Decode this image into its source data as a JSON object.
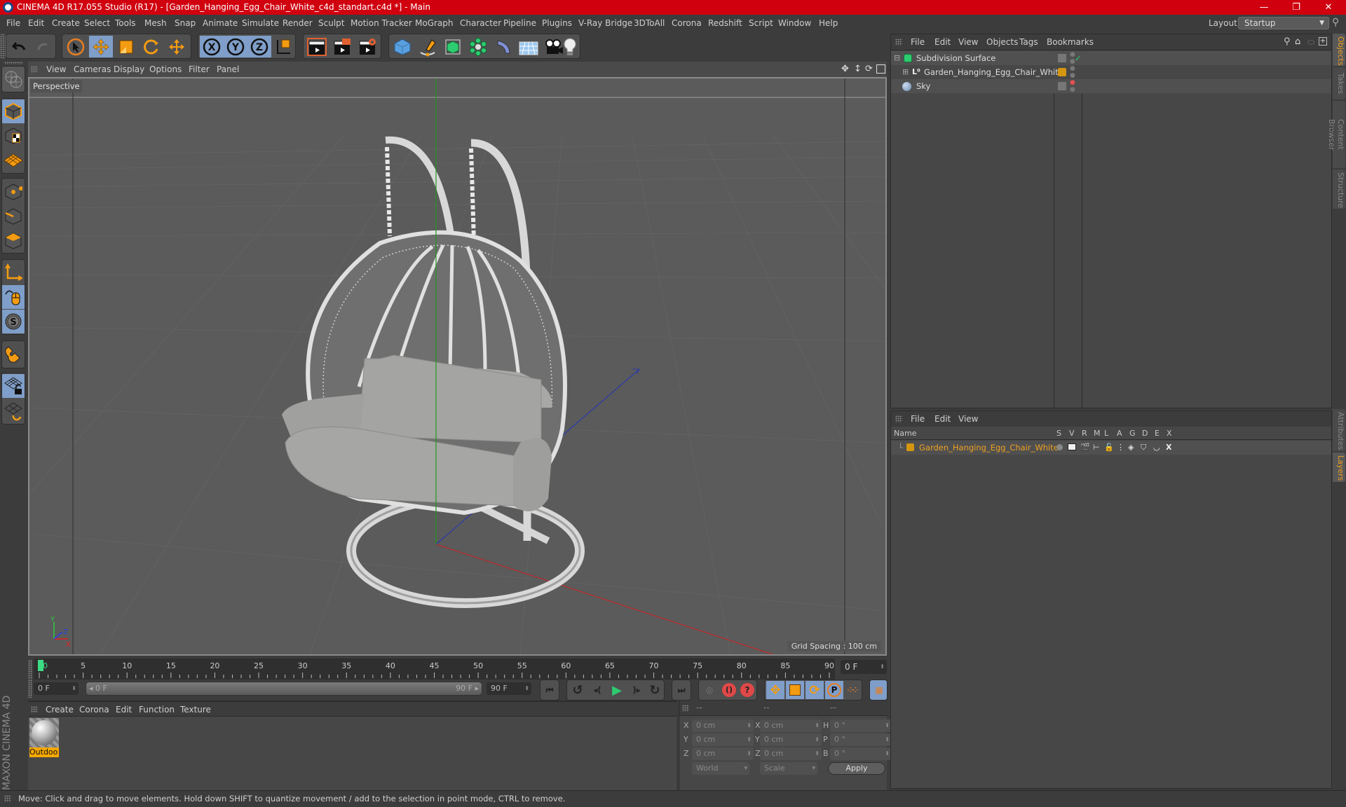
{
  "window": {
    "title": "CINEMA 4D R17.055 Studio (R17) - [Garden_Hanging_Egg_Chair_White_c4d_standart.c4d *] - Main",
    "controls": {
      "minimize": "—",
      "maximize": "❐",
      "close": "✕"
    }
  },
  "menubar": {
    "items": [
      "File",
      "Edit",
      "Create",
      "Select",
      "Tools",
      "Mesh",
      "Snap",
      "Animate",
      "Simulate",
      "Render",
      "Sculpt",
      "Motion Tracker",
      "MoGraph",
      "Character",
      "Pipeline",
      "Plugins",
      "V-Ray Bridge",
      "3DToAll",
      "Corona",
      "Redshift",
      "Script",
      "Window",
      "Help"
    ],
    "layout_label": "Layout:",
    "layout_value": "Startup"
  },
  "toolbar": {
    "icons": [
      "undo-icon",
      "redo-icon",
      "select-live-icon",
      "move-icon",
      "scale-icon",
      "rotate-icon",
      "transform-icon",
      "x-axis-lock-icon",
      "y-axis-lock-icon",
      "z-axis-lock-icon",
      "coordinate-system-icon",
      "render-view-icon",
      "render-picture-viewer-icon",
      "render-settings-icon",
      "cube-icon",
      "pen-spline-icon",
      "subdivision-icon",
      "cloner-icon",
      "deformer-icon",
      "floor-icon",
      "camera-icon",
      "light-icon"
    ]
  },
  "left_tools": {
    "icons": [
      "make-editable-icon",
      "model-mode-icon",
      "texture-mode-icon",
      "workplane-mode-icon",
      "points-mode-icon",
      "edges-mode-icon",
      "polygons-mode-icon",
      "axis-mode-icon",
      "tweak-mode-icon",
      "solo-mode-icon",
      "snapping-icon",
      "lock-workplane-icon",
      "workplane-rotate-icon"
    ]
  },
  "viewport": {
    "menu": [
      "View",
      "Cameras",
      "Display",
      "Options",
      "Filter",
      "Panel"
    ],
    "camera_label": "Perspective",
    "grid_spacing": "Grid Spacing : 100 cm",
    "axis_labels": {
      "x": "X",
      "y": "Y",
      "z": "Z"
    },
    "nav_icons": [
      "pan-icon",
      "dolly-icon",
      "orbit-icon",
      "maximize-view-icon"
    ]
  },
  "timeline": {
    "ticks": [
      "0",
      "5",
      "10",
      "15",
      "20",
      "25",
      "30",
      "35",
      "40",
      "45",
      "50",
      "55",
      "60",
      "65",
      "70",
      "75",
      "80",
      "85",
      "90"
    ],
    "current_frame": "0 F",
    "start_field": "0 F",
    "range_start": "0 F",
    "range_end": "90 F",
    "end_field": "90 F",
    "range_min": 0,
    "range_max": 90,
    "playhead": 0
  },
  "playback": {
    "buttons": [
      "go-to-start",
      "go-to-prev-key",
      "play-reverse-step",
      "play",
      "play-forward-step",
      "go-to-next-key",
      "go-to-end",
      "motion-record",
      "record-keys",
      "autokey-help",
      "key-position",
      "key-scale",
      "key-rotation",
      "key-param",
      "key-pla",
      "timeline-window"
    ]
  },
  "materials": {
    "menu": [
      "Create",
      "Corona",
      "Edit",
      "Function",
      "Texture"
    ],
    "items": [
      {
        "name": "Outdoo"
      }
    ]
  },
  "coordinates": {
    "headers": [
      "--",
      "--",
      "--"
    ],
    "rows": [
      {
        "a": "X",
        "av": "0 cm",
        "b": "X",
        "bv": "0 cm",
        "c": "H",
        "cv": "0 °"
      },
      {
        "a": "Y",
        "av": "0 cm",
        "b": "Y",
        "bv": "0 cm",
        "c": "P",
        "cv": "0 °"
      },
      {
        "a": "Z",
        "av": "0 cm",
        "b": "Z",
        "bv": "0 cm",
        "c": "B",
        "cv": "0 °"
      }
    ],
    "space_select": "World",
    "mode_select": "Scale",
    "apply_label": "Apply"
  },
  "objects_panel": {
    "menu": [
      "File",
      "Edit",
      "View",
      "Objects",
      "Tags",
      "Bookmarks"
    ],
    "rows": [
      {
        "name": "Subdivision Surface",
        "icon": "subdivision-icon",
        "expand": "⊟"
      },
      {
        "name": "Garden_Hanging_Egg_Chair_White",
        "icon": "null-object-icon",
        "expand": "⊞"
      },
      {
        "name": "Sky",
        "icon": "sky-icon",
        "expand": ""
      }
    ]
  },
  "layers_panel": {
    "menu": [
      "File",
      "Edit",
      "View"
    ],
    "columns": [
      "Name",
      "S",
      "V",
      "R",
      "M",
      "L",
      "A",
      "G",
      "D",
      "E",
      "X"
    ],
    "rows": [
      {
        "name": "Garden_Hanging_Egg_Chair_White",
        "color": "#d4960f"
      }
    ]
  },
  "side_tabs": {
    "top": [
      {
        "label": "Objects",
        "active": true
      },
      {
        "label": "Takes",
        "active": false
      },
      {
        "label": "Content Browser",
        "active": false
      },
      {
        "label": "Structure",
        "active": false
      }
    ],
    "bottom": [
      {
        "label": "Attributes",
        "active": false
      },
      {
        "label": "Layers",
        "active": true
      }
    ]
  },
  "branding": "MAXON CINEMA 4D",
  "status": "Move: Click and drag to move elements. Hold down SHIFT to quantize movement / add to the selection in point mode, CTRL to remove.",
  "colors": {
    "accent": "#f0a020",
    "title_bar": "#d0000f",
    "selected_tool": "#7f9ec9",
    "layer_color": "#d4960f"
  }
}
